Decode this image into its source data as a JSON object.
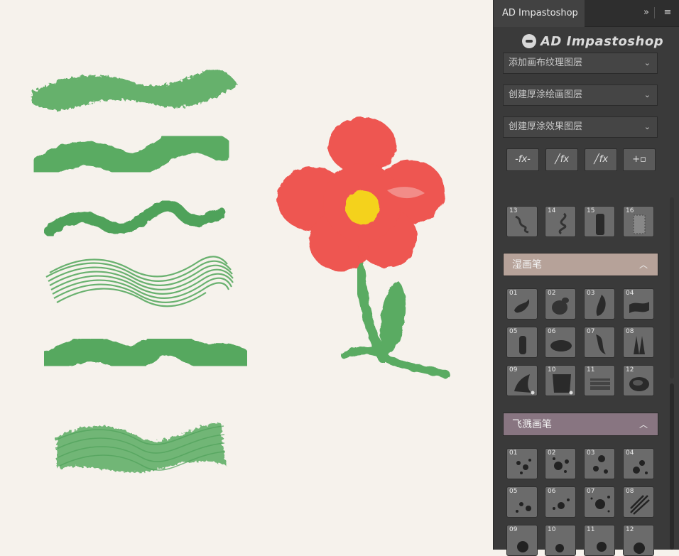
{
  "panel": {
    "tab_title": "AD Impastoshop",
    "expand_icon": "double-chevron-right-icon",
    "menu_icon": "hamburger-menu-icon",
    "logo_text": "AD Impastoshop",
    "dropdowns": [
      {
        "label": "添加画布纹理图层"
      },
      {
        "label": "创建厚涂绘画图层"
      },
      {
        "label": "创建厚涂效果图层"
      }
    ],
    "fx_buttons": [
      {
        "label": "-fx-",
        "icon": "remove-fx-icon"
      },
      {
        "label": "fx",
        "icon": "brush-fx-icon"
      },
      {
        "label": "fx",
        "icon": "knife-fx-icon"
      },
      {
        "label": "+",
        "icon": "add-layer-icon"
      }
    ],
    "dry_brushes": [
      "13",
      "14",
      "15",
      "16"
    ],
    "wet_section": {
      "title": "湿画笔",
      "brushes": [
        "01",
        "02",
        "03",
        "04",
        "05",
        "06",
        "07",
        "08",
        "09",
        "10",
        "11",
        "12"
      ]
    },
    "splash_section": {
      "title": "飞溅画笔",
      "brushes": [
        "01",
        "02",
        "03",
        "04",
        "05",
        "06",
        "07",
        "08",
        "09",
        "10",
        "11",
        "12"
      ]
    }
  },
  "colors": {
    "canvas_bg": "#f6f2ec",
    "stroke_green": "#5aab62",
    "petal_red": "#ee5651",
    "flower_center": "#f4d21f",
    "panel_bg": "#3a3a3a",
    "wet_header": "#b6a299",
    "splash_header": "#887581"
  }
}
